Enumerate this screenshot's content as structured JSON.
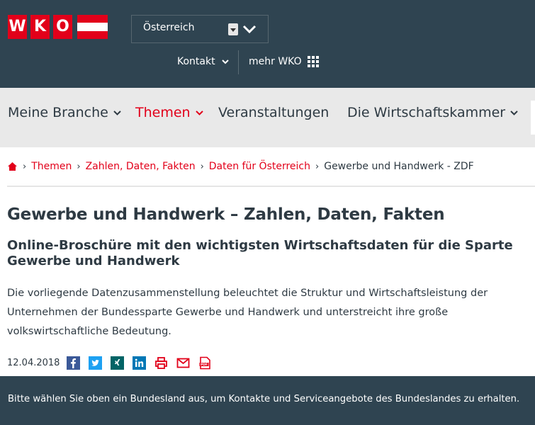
{
  "header": {
    "logo_letters": [
      "W",
      "K",
      "O"
    ],
    "country_select": {
      "value": "Österreich"
    },
    "kontakt_label": "Kontakt",
    "mehr_label": "mehr WKO"
  },
  "nav": {
    "items": [
      {
        "label": "Meine Branche",
        "active": false
      },
      {
        "label": "Themen",
        "active": true
      },
      {
        "label": "Veranstaltungen",
        "active": false
      },
      {
        "label": "Die Wirtschaftskammer",
        "active": false
      }
    ]
  },
  "breadcrumb": {
    "home_icon": "home-icon",
    "links": [
      "Themen",
      "Zahlen, Daten, Fakten",
      "Daten für Österreich"
    ],
    "current": "Gewerbe und Handwerk - ZDF"
  },
  "article": {
    "title": "Gewerbe und Handwerk – Zahlen, Daten, Fakten",
    "subtitle": "Online-Broschüre mit den wichtigsten Wirtschaftsdaten für die Sparte Gewerbe und Handwerk",
    "lead": "Die vorliegende Datenzusammenstellung beleuchtet die Struktur und Wirtschaftsleistung der Unternehmen der Bundessparte Gewerbe und Handwerk und unterstreicht ihre große volkswirtschaftliche Bedeutung.",
    "date": "12.04.2018",
    "share_icons": [
      "facebook-icon",
      "twitter-icon",
      "xing-icon",
      "linkedin-icon",
      "print-icon",
      "mail-icon",
      "pdf-icon"
    ]
  },
  "banner": {
    "text": "Bitte wählen Sie oben ein Bundesland aus, um Kontakte und Serviceangebote des Bundeslandes zu erhalten."
  },
  "colors": {
    "brand_red": "#e2001a",
    "header_dark": "#2f4451",
    "nav_gray": "#e9e9e9"
  }
}
